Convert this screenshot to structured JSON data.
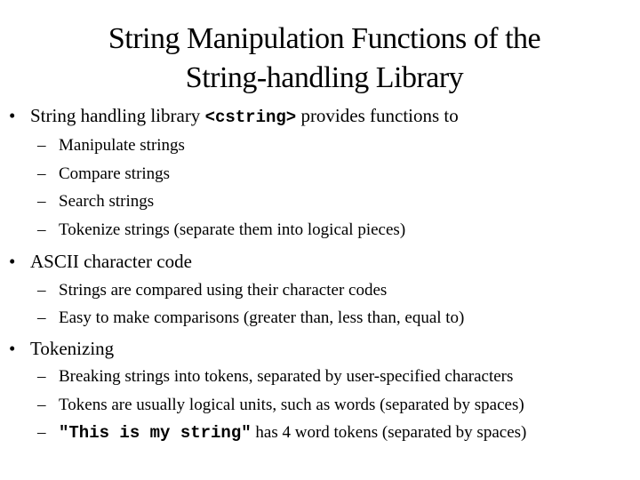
{
  "slide": {
    "title_line1": "String Manipulation Functions of the",
    "title_line2": "String-handling Library",
    "bullet_glyph": "•",
    "dash_glyph": "–",
    "sections": [
      {
        "text_before": "String handling library ",
        "code": "<cstring>",
        "text_after": " provides functions to",
        "subitems": [
          "Manipulate strings",
          "Compare strings",
          "Search strings",
          "Tokenize strings (separate them into logical pieces)"
        ]
      },
      {
        "text": "ASCII character code",
        "subitems": [
          "Strings are compared using their character codes",
          "Easy to make comparisons (greater than, less than, equal to)"
        ]
      },
      {
        "text": "Tokenizing",
        "subitems": [
          "Breaking strings into tokens, separated by user-specified characters",
          "Tokens are usually logical units, such as words (separated by spaces)"
        ],
        "last_subitem": {
          "code": "\"This is my string\"",
          "text": " has 4 word tokens (separated by spaces)"
        }
      }
    ]
  }
}
